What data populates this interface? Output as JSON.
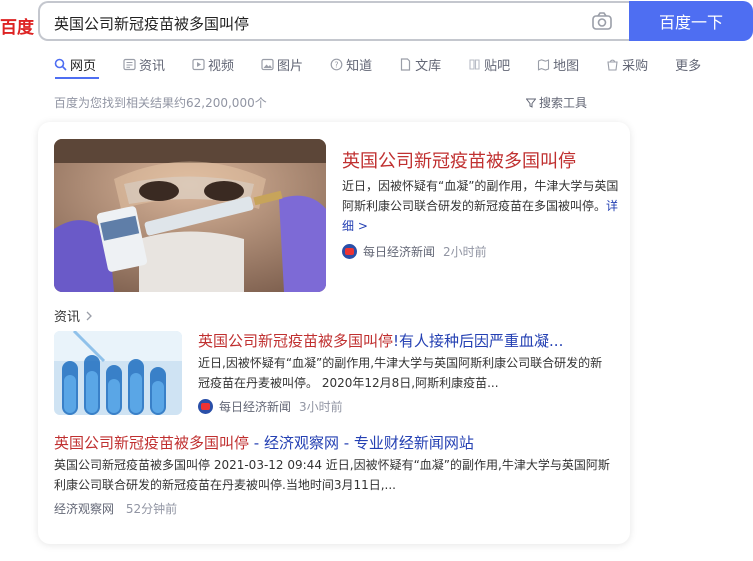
{
  "logo_fragment": "百度",
  "search": {
    "query": "英国公司新冠疫苗被多国叫停",
    "button_label": "百度一下"
  },
  "tabs": [
    {
      "label": "网页",
      "icon": "search-icon"
    },
    {
      "label": "资讯",
      "icon": "news-icon"
    },
    {
      "label": "视频",
      "icon": "video-icon"
    },
    {
      "label": "图片",
      "icon": "image-icon"
    },
    {
      "label": "知道",
      "icon": "question-icon"
    },
    {
      "label": "文库",
      "icon": "document-icon"
    },
    {
      "label": "贴吧",
      "icon": "tieba-icon"
    },
    {
      "label": "地图",
      "icon": "map-icon"
    },
    {
      "label": "采购",
      "icon": "shopping-icon"
    },
    {
      "label": "更多",
      "icon": ""
    }
  ],
  "result_count": "百度为您找到相关结果约62,200,000个",
  "tools_label": "搜索工具",
  "main_result": {
    "title": "英国公司新冠疫苗被多国叫停",
    "description": "近日，因被怀疑有“血凝”的副作用，牛津大学与英国阿斯利康公司联合研发的新冠疫苗在多国被叫停。",
    "more_link": "详细 >",
    "source": "每日经济新闻",
    "time": "2小时前"
  },
  "news_section_label": "资讯",
  "sub_result": {
    "title_red": "英国公司新冠疫苗被多国叫停",
    "title_rest": "!有人接种后因严重血凝...",
    "description": "近日,因被怀疑有“血凝”的副作用,牛津大学与英国阿斯利康公司联合研发的新冠疫苗在丹麦被叫停。 2020年12月8日,阿斯利康疫苗...",
    "source": "每日经济新闻",
    "time": "3小时前"
  },
  "third_result": {
    "title_red": "英国公司新冠疫苗被多国叫停",
    "title_rest": " - 经济观察网 - 专业财经新闻网站",
    "description": "英国公司新冠疫苗被多国叫停 2021-03-12 09:44 近日,因被怀疑有“血凝”的副作用,牛津大学与英国阿斯利康公司联合研发的新冠疫苗在丹麦被叫停.当地时间3月11日,...",
    "source": "经济观察网",
    "time": "52分钟前"
  },
  "colors": {
    "accent": "#4e6ef2",
    "title_red": "#c03030",
    "link_blue": "#2440b3"
  }
}
